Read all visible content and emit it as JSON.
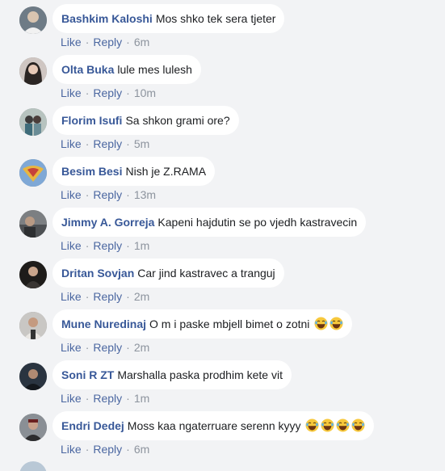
{
  "actions": {
    "like": "Like",
    "reply": "Reply",
    "separator": "·"
  },
  "comments": [
    {
      "author": "Bashkim Kaloshi",
      "text": "Mos shko tek sera tjeter",
      "time": "6m",
      "emoji": []
    },
    {
      "author": "Olta Buka",
      "text": "lule mes lulesh",
      "time": "10m",
      "emoji": []
    },
    {
      "author": "Florim Isufi",
      "text": "Sa shkon grami ore?",
      "time": "5m",
      "emoji": []
    },
    {
      "author": "Besim Besi",
      "text": "Nish je Z.RAMA",
      "time": "13m",
      "emoji": []
    },
    {
      "author": "Jimmy A. Gorreja",
      "text": "Kapeni hajdutin se po vjedh kastravecin",
      "time": "1m",
      "emoji": []
    },
    {
      "author": "Dritan Sovjan",
      "text": "Car jind kastravec a tranguj",
      "time": "2m",
      "emoji": []
    },
    {
      "author": "Mune Nuredinaj",
      "text": "O m i paske mbjell bimet o zotni",
      "time": "2m",
      "emoji": [
        "laughing-emoji",
        "laughing-emoji"
      ]
    },
    {
      "author": "Soni R ZT",
      "text": "Marshalla paska prodhim kete vit",
      "time": "1m",
      "emoji": []
    },
    {
      "author": "Endri Dedej",
      "text": "Moss kaa ngaterruare serenn kyyy",
      "time": "6m",
      "emoji": [
        "laughing-emoji",
        "laughing-emoji",
        "laughing-emoji",
        "laughing-emoji"
      ]
    }
  ],
  "colors": {
    "background": "#f2f3f5",
    "bubble": "#ffffff",
    "author": "#385898",
    "link": "#4b67a1",
    "meta": "#8d949e"
  }
}
